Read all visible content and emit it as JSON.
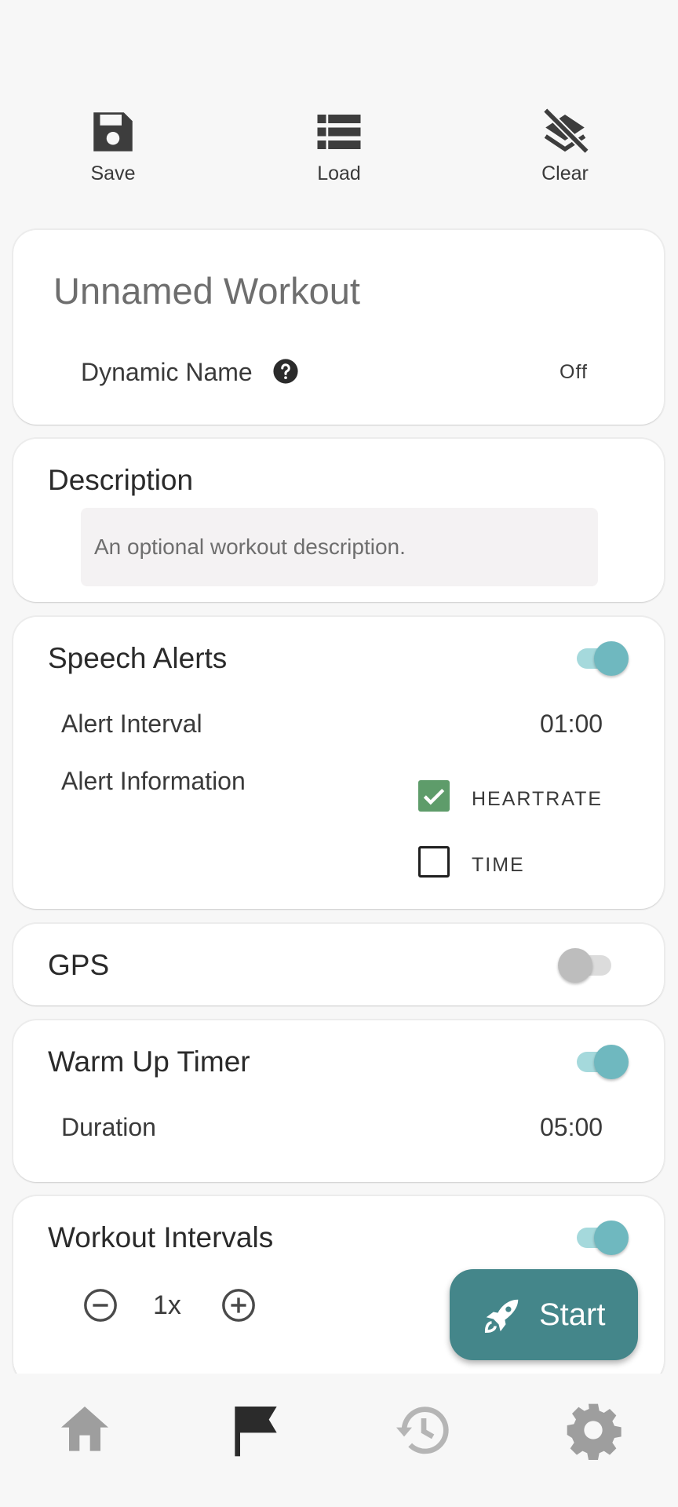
{
  "toolbar": {
    "save_label": "Save",
    "load_label": "Load",
    "clear_label": "Clear"
  },
  "workout": {
    "name_placeholder": "Unnamed Workout",
    "dynamic_name_label": "Dynamic Name",
    "dynamic_name_value": "Off"
  },
  "description": {
    "title": "Description",
    "placeholder": "An optional workout description."
  },
  "speech_alerts": {
    "title": "Speech Alerts",
    "enabled": true,
    "interval_label": "Alert Interval",
    "interval_value": "01:00",
    "info_label": "Alert Information",
    "options": [
      {
        "label": "HEARTRATE",
        "checked": true
      },
      {
        "label": "TIME",
        "checked": false
      }
    ]
  },
  "gps": {
    "title": "GPS",
    "enabled": false
  },
  "warm_up": {
    "title": "Warm Up Timer",
    "enabled": true,
    "duration_label": "Duration",
    "duration_value": "05:00"
  },
  "intervals": {
    "title": "Workout Intervals",
    "enabled": true,
    "multiplier": "1x"
  },
  "fab": {
    "label": "Start",
    "icon": "rocket-icon"
  },
  "bottom_nav": [
    {
      "icon": "home-icon",
      "active": false
    },
    {
      "icon": "flag-icon",
      "active": true
    },
    {
      "icon": "history-icon",
      "active": false
    },
    {
      "icon": "gear-icon",
      "active": false
    }
  ],
  "colors": {
    "accent": "#44868a",
    "toggle_on": "#6fb8bf",
    "check_green": "#5e9c6a"
  }
}
